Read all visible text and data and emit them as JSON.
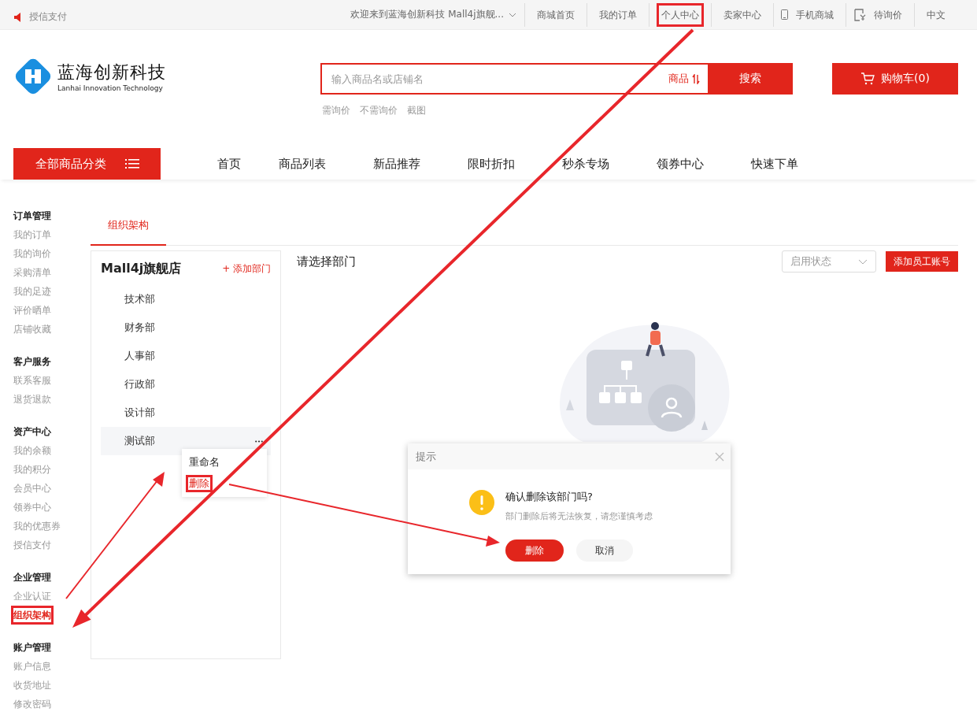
{
  "topbar": {
    "left_link": "授信支付",
    "welcome": "欢迎来到蓝海创新科技 Mall4j旗舰...",
    "links": [
      {
        "label": "商城首页",
        "kind": "text",
        "highlighted": false
      },
      {
        "label": "我的订单",
        "kind": "text",
        "highlighted": false
      },
      {
        "label": "个人中心",
        "kind": "text",
        "highlighted": true
      },
      {
        "label": "卖家中心",
        "kind": "text",
        "highlighted": false
      },
      {
        "label": "手机商城",
        "kind": "phone",
        "highlighted": false
      },
      {
        "label": "待询价",
        "kind": "quote",
        "highlighted": false
      },
      {
        "label": "中文",
        "kind": "text",
        "highlighted": false
      }
    ]
  },
  "logo": {
    "name": "蓝海创新科技",
    "subtitle": "Lanhai Innovation Technology"
  },
  "search": {
    "placeholder": "输入商品名或店铺名",
    "scope": "商品",
    "button": "搜索",
    "hints": [
      "需询价",
      "不需询价",
      "截图"
    ]
  },
  "cart": {
    "label": "购物车(0)"
  },
  "nav": {
    "all_categories": "全部商品分类",
    "items": [
      "首页",
      "商品列表",
      "新品推荐",
      "限时折扣",
      "秒杀专场",
      "领券中心",
      "快速下单"
    ]
  },
  "sidebar": [
    {
      "title": "订单管理",
      "items": [
        {
          "label": "我的订单",
          "selected": false
        },
        {
          "label": "我的询价",
          "selected": false
        },
        {
          "label": "采购清单",
          "selected": false
        },
        {
          "label": "我的足迹",
          "selected": false
        },
        {
          "label": "评价晒单",
          "selected": false
        },
        {
          "label": "店铺收藏",
          "selected": false
        }
      ]
    },
    {
      "title": "客户服务",
      "items": [
        {
          "label": "联系客服",
          "selected": false
        },
        {
          "label": "退货退款",
          "selected": false
        }
      ]
    },
    {
      "title": "资产中心",
      "items": [
        {
          "label": "我的余额",
          "selected": false
        },
        {
          "label": "我的积分",
          "selected": false
        },
        {
          "label": "会员中心",
          "selected": false
        },
        {
          "label": "领券中心",
          "selected": false
        },
        {
          "label": "我的优惠券",
          "selected": false
        },
        {
          "label": "授信支付",
          "selected": false
        }
      ]
    },
    {
      "title": "企业管理",
      "items": [
        {
          "label": "企业认证",
          "selected": false
        },
        {
          "label": "组织架构",
          "selected": true,
          "highlighted": true
        }
      ]
    },
    {
      "title": "账户管理",
      "items": [
        {
          "label": "账户信息",
          "selected": false
        },
        {
          "label": "收货地址",
          "selected": false
        },
        {
          "label": "修改密码",
          "selected": false
        }
      ]
    }
  ],
  "tabs": [
    {
      "label": "组织架构",
      "selected": true
    }
  ],
  "departments": {
    "store": "Mall4j旗舰店",
    "add": "+ 添加部门",
    "items": [
      {
        "name": "技术部",
        "selected": false
      },
      {
        "name": "财务部",
        "selected": false
      },
      {
        "name": "人事部",
        "selected": false
      },
      {
        "name": "行政部",
        "selected": false
      },
      {
        "name": "设计部",
        "selected": false
      },
      {
        "name": "测试部",
        "selected": true
      }
    ],
    "menu": [
      {
        "label": "重命名",
        "highlighted": false
      },
      {
        "label": "删除",
        "highlighted": true
      }
    ]
  },
  "staff": {
    "title": "请选择部门",
    "status_placeholder": "启用状态",
    "add_button": "添加员工账号"
  },
  "dialog": {
    "title": "提示",
    "message": "确认删除该部门吗?",
    "detail": "部门删除后将无法恢复，请您谨慎考虑",
    "confirm": "删除",
    "cancel": "取消"
  }
}
